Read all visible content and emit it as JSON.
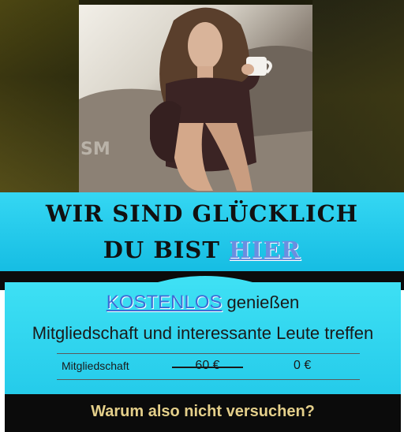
{
  "hero": {
    "photo_icon": "woman-with-cup-photo"
  },
  "banner": {
    "line1": "WIR SIND GLÜCKLICH",
    "line2_prefix": "DU BIST",
    "line2_highlight": "HIER"
  },
  "offer": {
    "highlight": "KOSTENLOS",
    "line1_rest": "genießen",
    "line2": "Mitgliedschaft und interessante Leute treffen",
    "price_label": "Mitgliedschaft",
    "old_price": "60 €",
    "new_price": "0 €"
  },
  "footer": {
    "cta": "Warum also nicht versuchen?"
  },
  "colors": {
    "banner": "#16bde3",
    "offer": "#25cbea",
    "highlight_text": "#3b6ed6",
    "cta_text": "#e4cf8a",
    "footer_bg": "#0b0b0b"
  }
}
